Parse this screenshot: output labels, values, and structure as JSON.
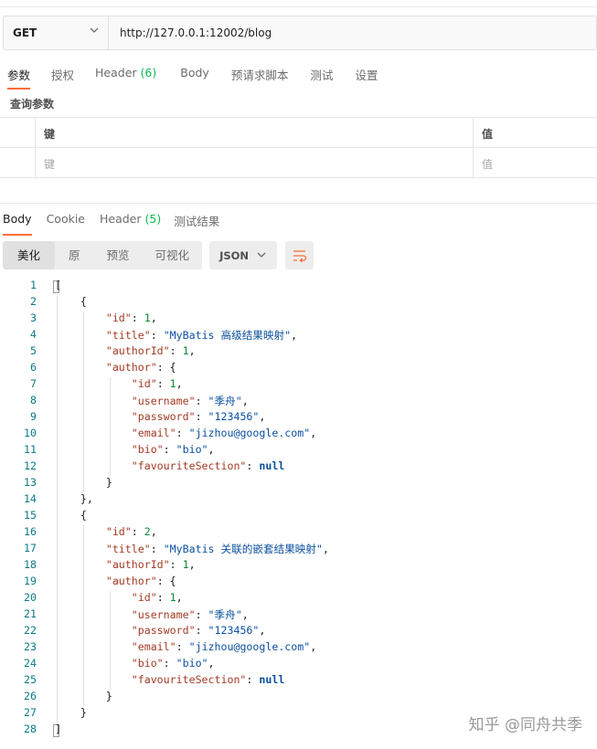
{
  "request": {
    "method": "GET",
    "url": "http://127.0.0.1:12002/blog"
  },
  "request_tabs": [
    {
      "label": "参数",
      "count": ""
    },
    {
      "label": "授权",
      "count": ""
    },
    {
      "label": "Header",
      "count": "(6)"
    },
    {
      "label": "Body",
      "count": ""
    },
    {
      "label": "预请求脚本",
      "count": ""
    },
    {
      "label": "测试",
      "count": ""
    },
    {
      "label": "设置",
      "count": ""
    }
  ],
  "params": {
    "title": "查询参数",
    "key_header": "键",
    "value_header": "值",
    "key_placeholder": "键",
    "value_placeholder": "值"
  },
  "response_tabs": [
    {
      "label": "Body",
      "count": ""
    },
    {
      "label": "Cookie",
      "count": ""
    },
    {
      "label": "Header",
      "count": "(5)"
    },
    {
      "label": "测试结果",
      "count": ""
    }
  ],
  "view_modes": [
    "美化",
    "原",
    "预览",
    "可视化"
  ],
  "format": "JSON",
  "code_lines": [
    "[",
    "    {",
    "        \"id\": 1,",
    "        \"title\": \"MyBatis 高级结果映射\",",
    "        \"authorId\": 1,",
    "        \"author\": {",
    "            \"id\": 1,",
    "            \"username\": \"季舟\",",
    "            \"password\": \"123456\",",
    "            \"email\": \"jizhou@google.com\",",
    "            \"bio\": \"bio\",",
    "            \"favouriteSection\": null",
    "        }",
    "    },",
    "    {",
    "        \"id\": 2,",
    "        \"title\": \"MyBatis 关联的嵌套结果映射\",",
    "        \"authorId\": 1,",
    "        \"author\": {",
    "            \"id\": 1,",
    "            \"username\": \"季舟\",",
    "            \"password\": \"123456\",",
    "            \"email\": \"jizhou@google.com\",",
    "            \"bio\": \"bio\",",
    "            \"favouriteSection\": null",
    "        }",
    "    }",
    "]"
  ],
  "watermark": "知乎 @同舟共季",
  "colors": {
    "accent": "#ff6c37",
    "count_green": "#0cbb52",
    "line_number": "#0a7a86"
  },
  "icons": {
    "method_dropdown": "chevron-down-icon",
    "format_dropdown": "chevron-down-icon",
    "wrap": "wrap-lines-icon"
  }
}
